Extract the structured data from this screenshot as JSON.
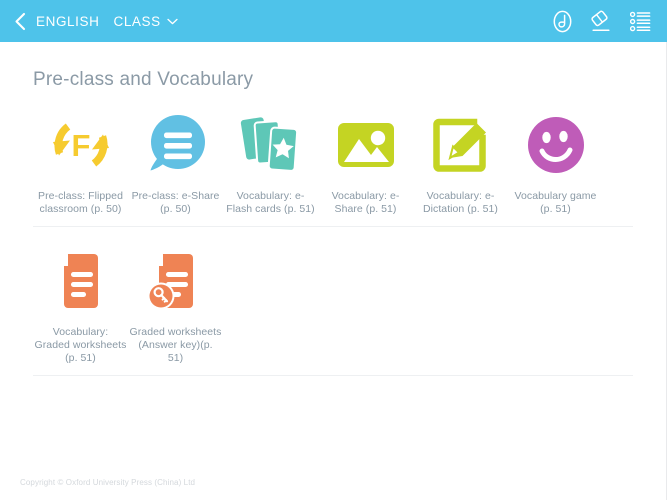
{
  "topbar": {
    "back_icon": "chevron-left-icon",
    "breadcrumb_subject": "ENGLISH",
    "class_label": "CLASS",
    "class_caret_icon": "chevron-down-icon",
    "tools": [
      {
        "name": "attachment-icon",
        "label": "Attachment"
      },
      {
        "name": "eraser-icon",
        "label": "Eraser"
      },
      {
        "name": "list-menu-icon",
        "label": "Menu"
      }
    ],
    "background_color": "#4ec3ea"
  },
  "main": {
    "page_title": "Pre-class and Vocabulary",
    "rows": [
      {
        "tiles": [
          {
            "icon": "flipped-classroom-icon",
            "label": "Pre-class: Flipped classroom (p. 50)",
            "color": "#f6cb2f"
          },
          {
            "icon": "speech-bubble-lines-icon",
            "label": "Pre-class: e-Share (p. 50)",
            "color": "#61c0e3"
          },
          {
            "icon": "flash-cards-star-icon",
            "label": "Vocabulary: e-Flash cards (p. 51)",
            "color": "#5ec7b7"
          },
          {
            "icon": "picture-icon",
            "label": "Vocabulary: e-Share (p. 51)",
            "color": "#c4d423"
          },
          {
            "icon": "edit-square-pencil-icon",
            "label": "Vocabulary: e-Dictation (p. 51)",
            "color": "#c4d423"
          },
          {
            "icon": "smiley-face-icon",
            "label": "Vocabulary game (p. 51)",
            "color": "#bf5cb8"
          }
        ]
      },
      {
        "tiles": [
          {
            "icon": "worksheet-document-icon",
            "label": "Vocabulary: Graded worksheets (p. 51)",
            "color": "#ef8354"
          },
          {
            "icon": "worksheet-answer-key-icon",
            "label": "Graded worksheets (Answer key)(p. 51)",
            "color": "#ef8354"
          }
        ]
      }
    ]
  },
  "footer": {
    "copyright": "Copyright © Oxford University Press (China) Ltd"
  }
}
